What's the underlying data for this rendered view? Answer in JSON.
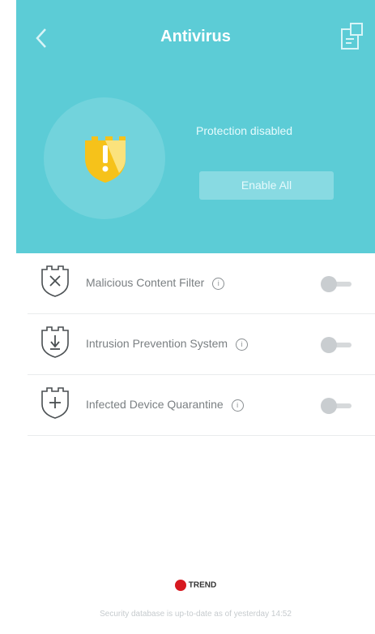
{
  "header": {
    "title": "Antivirus",
    "status": "Protection disabled",
    "enable_all_label": "Enable All",
    "color": "#5cccd6"
  },
  "icons": {
    "back": "chevron-left-icon",
    "report": "report-icon",
    "shield": "shield-warning-icon"
  },
  "features": [
    {
      "label": "Malicious Content Filter",
      "icon": "shield-x-icon",
      "enabled": false
    },
    {
      "label": "Intrusion Prevention System",
      "icon": "shield-arrow-icon",
      "enabled": false
    },
    {
      "label": "Infected Device Quarantine",
      "icon": "shield-plus-icon",
      "enabled": false
    }
  ],
  "footer": {
    "brand": "TREND",
    "database_status": "Security database is up-to-date as of yesterday 14:52"
  }
}
